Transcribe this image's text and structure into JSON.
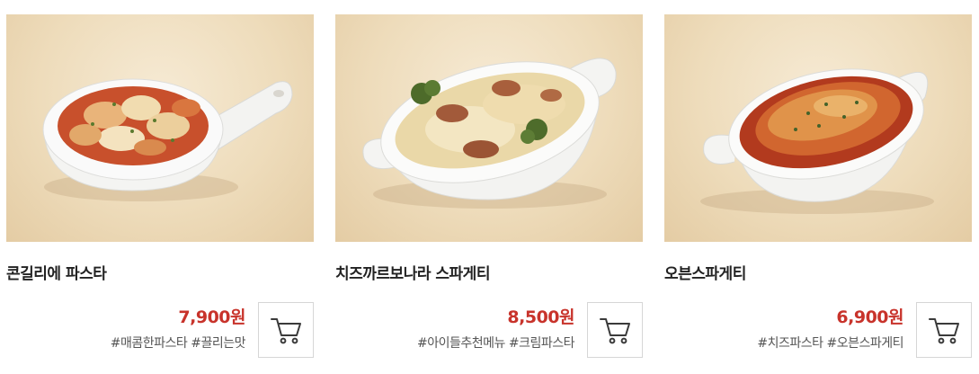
{
  "products": [
    {
      "name": "콘길리에 파스타",
      "price": "7,900원",
      "tags": "#매콤한파스타 #끌리는맛",
      "cart_icon": "shopping-cart-icon"
    },
    {
      "name": "치즈까르보나라 스파게티",
      "price": "8,500원",
      "tags": "#아이들추천메뉴 #크림파스타",
      "cart_icon": "shopping-cart-icon"
    },
    {
      "name": "오븐스파게티",
      "price": "6,900원",
      "tags": "#치즈파스타 #오븐스파게티",
      "cart_icon": "shopping-cart-icon"
    }
  ],
  "colors": {
    "price": "#c8332b",
    "title": "#222222",
    "tags": "#555555",
    "background_wood": "#eedcbb"
  }
}
